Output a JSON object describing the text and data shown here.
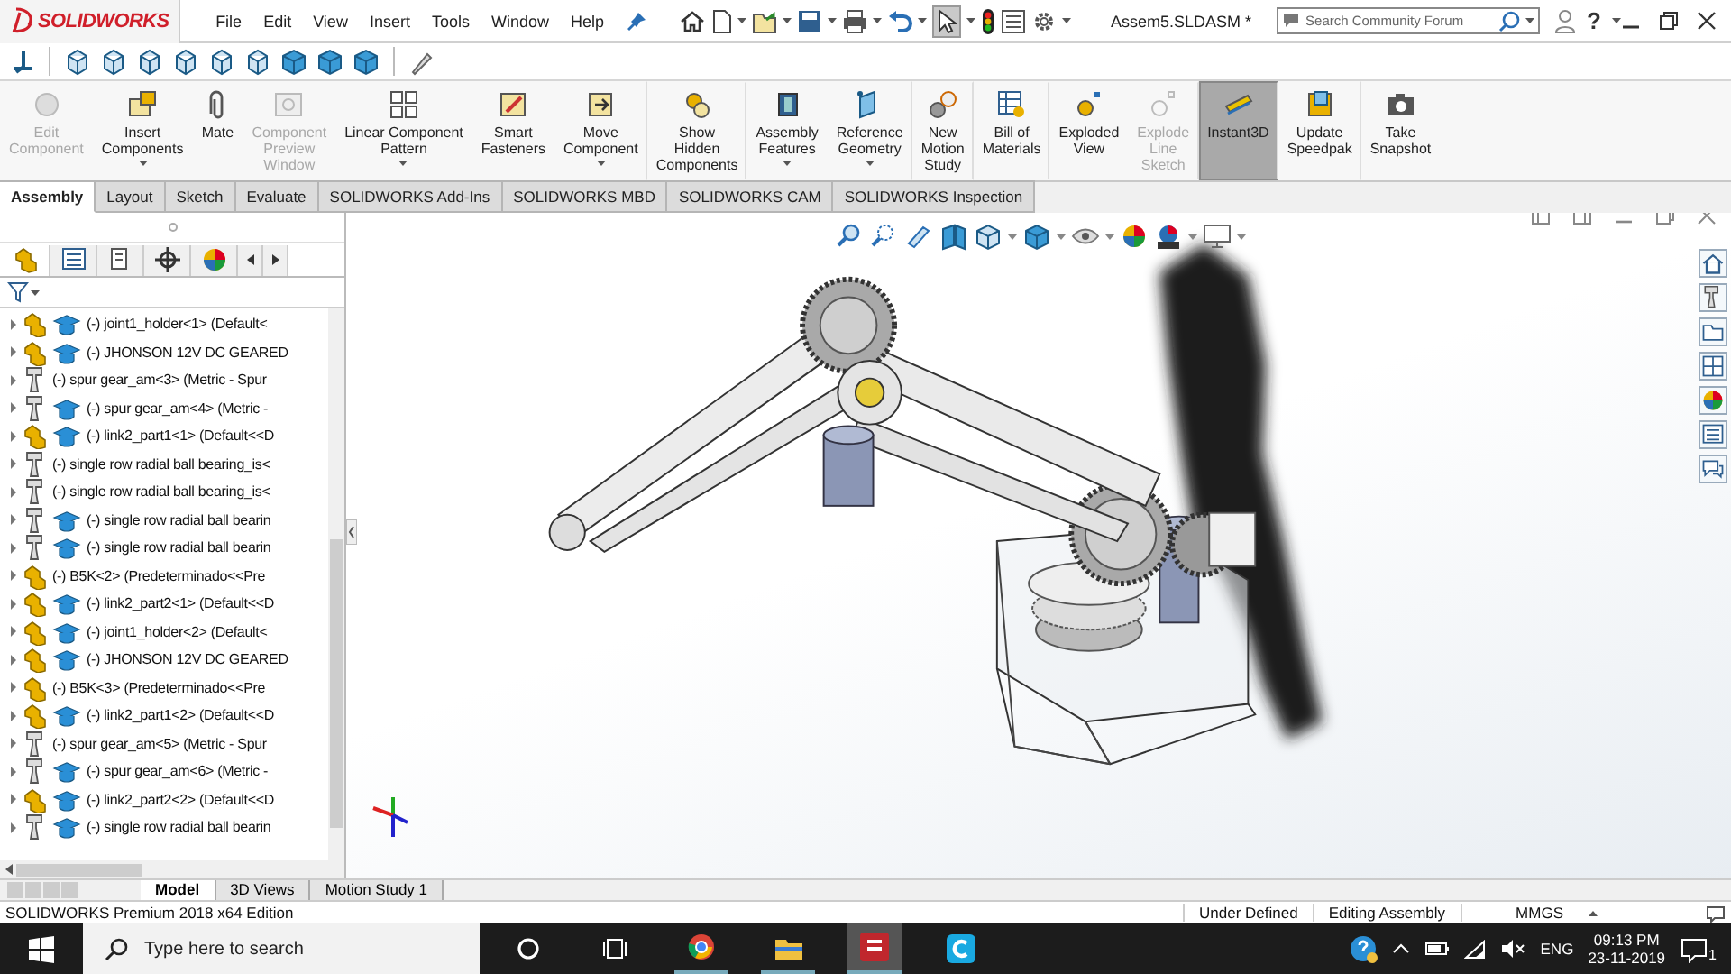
{
  "app": {
    "logo": "SOLIDWORKS",
    "menu": [
      "File",
      "Edit",
      "View",
      "Insert",
      "Tools",
      "Window",
      "Help"
    ],
    "document_title": "Assem5.SLDASM *",
    "search": {
      "placeholder": "Search Community Forum"
    },
    "help_glyph": "?"
  },
  "ribbon": {
    "buttons": [
      {
        "label": "Edit\nComponent",
        "disabled": true,
        "selected": false,
        "has_menu": false
      },
      {
        "label": "Insert\nComponents",
        "disabled": false,
        "selected": false,
        "has_menu": true
      },
      {
        "label": "Mate",
        "disabled": false,
        "selected": false,
        "has_menu": false
      },
      {
        "label": "Component\nPreview\nWindow",
        "disabled": true,
        "selected": false,
        "has_menu": false
      },
      {
        "label": "Linear Component\nPattern",
        "disabled": false,
        "selected": false,
        "has_menu": true
      },
      {
        "label": "Smart\nFasteners",
        "disabled": false,
        "selected": false,
        "has_menu": false
      },
      {
        "label": "Move\nComponent",
        "disabled": false,
        "selected": false,
        "has_menu": true
      },
      {
        "label": "Show\nHidden\nComponents",
        "disabled": false,
        "selected": false,
        "has_menu": false
      },
      {
        "label": "Assembly\nFeatures",
        "disabled": false,
        "selected": false,
        "has_menu": true
      },
      {
        "label": "Reference\nGeometry",
        "disabled": false,
        "selected": false,
        "has_menu": true
      },
      {
        "label": "New\nMotion\nStudy",
        "disabled": false,
        "selected": false,
        "has_menu": false
      },
      {
        "label": "Bill of\nMaterials",
        "disabled": false,
        "selected": false,
        "has_menu": false
      },
      {
        "label": "Exploded\nView",
        "disabled": false,
        "selected": false,
        "has_menu": false
      },
      {
        "label": "Explode\nLine\nSketch",
        "disabled": true,
        "selected": false,
        "has_menu": false
      },
      {
        "label": "Instant3D",
        "disabled": false,
        "selected": true,
        "has_menu": false
      },
      {
        "label": "Update\nSpeedpak",
        "disabled": false,
        "selected": false,
        "has_menu": false
      },
      {
        "label": "Take\nSnapshot",
        "disabled": false,
        "selected": false,
        "has_menu": false
      }
    ]
  },
  "command_tabs": [
    {
      "label": "Assembly",
      "selected": true
    },
    {
      "label": "Layout",
      "selected": false
    },
    {
      "label": "Sketch",
      "selected": false
    },
    {
      "label": "Evaluate",
      "selected": false
    },
    {
      "label": "SOLIDWORKS Add-Ins",
      "selected": false
    },
    {
      "label": "SOLIDWORKS MBD",
      "selected": false
    },
    {
      "label": "SOLIDWORKS CAM",
      "selected": false
    },
    {
      "label": "SOLIDWORKS Inspection",
      "selected": false
    }
  ],
  "feature_tree": {
    "items": [
      {
        "label": "(-) joint1_holder<1> (Default<",
        "kind": "assembly",
        "cap_badge": true
      },
      {
        "label": "(-) JHONSON 12V DC GEARED",
        "kind": "assembly",
        "cap_badge": true
      },
      {
        "label": "(-) spur gear_am<3> (Metric - Spur",
        "kind": "part",
        "cap_badge": false
      },
      {
        "label": "(-) spur gear_am<4> (Metric -",
        "kind": "part",
        "cap_badge": true
      },
      {
        "label": "(-) link2_part1<1> (Default<<D",
        "kind": "assembly",
        "cap_badge": true
      },
      {
        "label": "(-) single row radial ball bearing_is<",
        "kind": "part",
        "cap_badge": false
      },
      {
        "label": "(-) single row radial ball bearing_is<",
        "kind": "part",
        "cap_badge": false
      },
      {
        "label": "(-) single row radial ball bearin",
        "kind": "part",
        "cap_badge": true
      },
      {
        "label": "(-) single row radial ball bearin",
        "kind": "part",
        "cap_badge": true
      },
      {
        "label": "(-) B5K<2> (Predeterminado<<Pre",
        "kind": "assembly",
        "cap_badge": false
      },
      {
        "label": "(-) link2_part2<1> (Default<<D",
        "kind": "assembly",
        "cap_badge": true
      },
      {
        "label": "(-) joint1_holder<2> (Default<",
        "kind": "assembly",
        "cap_badge": true
      },
      {
        "label": "(-) JHONSON 12V DC GEARED",
        "kind": "assembly",
        "cap_badge": true
      },
      {
        "label": "(-) B5K<3> (Predeterminado<<Pre",
        "kind": "assembly",
        "cap_badge": false
      },
      {
        "label": "(-) link2_part1<2> (Default<<D",
        "kind": "assembly",
        "cap_badge": true
      },
      {
        "label": "(-) spur gear_am<5> (Metric - Spur",
        "kind": "part",
        "cap_badge": false
      },
      {
        "label": "(-) spur gear_am<6> (Metric -",
        "kind": "part",
        "cap_badge": true
      },
      {
        "label": "(-) link2_part2<2> (Default<<D",
        "kind": "assembly",
        "cap_badge": true
      },
      {
        "label": "(-) single row radial ball bearin",
        "kind": "part",
        "cap_badge": true
      }
    ]
  },
  "view_tabs": [
    {
      "label": "Model",
      "selected": true
    },
    {
      "label": "3D Views",
      "selected": false
    },
    {
      "label": "Motion Study 1",
      "selected": false
    }
  ],
  "status_bar": {
    "edition": "SOLIDWORKS Premium 2018 x64 Edition",
    "state": "Under Defined",
    "mode": "Editing Assembly",
    "units": "MMGS"
  },
  "taskbar": {
    "search": {
      "placeholder": "Type here to search"
    },
    "language": "ENG",
    "time": "09:13 PM",
    "date": "23-11-2019",
    "notifications": "1"
  }
}
